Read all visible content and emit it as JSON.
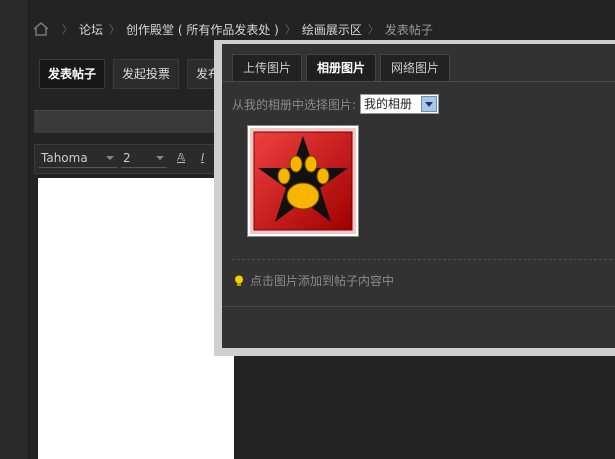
{
  "breadcrumb": {
    "items": [
      "论坛",
      "创作殿堂 ( 所有作品发表处 )",
      "绘画展示区",
      "发表帖子"
    ]
  },
  "actions": {
    "post_thread": "发表帖子",
    "start_poll": "发起投票",
    "publish_partial": "发布"
  },
  "editor": {
    "font": "Tahoma",
    "size": "2"
  },
  "image_dialog": {
    "tabs": [
      "上传图片",
      "相册图片",
      "网络图片"
    ],
    "active_tab": "相册图片",
    "album_label": "从我的相册中选择图片:",
    "album_value": "我的相册",
    "hint": "点击图片添加到帖子内容中"
  },
  "colors": {
    "thumb_red": "#d40000",
    "thumb_paw": "#f7b500",
    "star_black": "#111111"
  }
}
